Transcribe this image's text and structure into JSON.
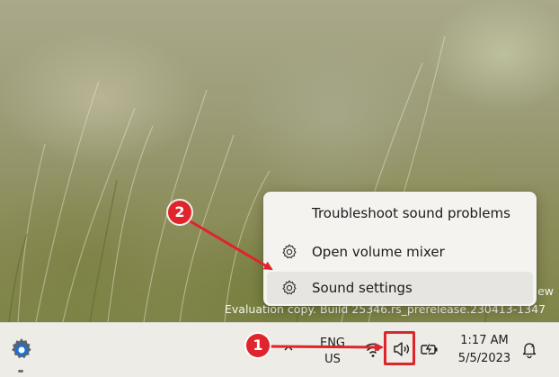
{
  "context_menu": {
    "items": [
      {
        "label": "Troubleshoot sound problems",
        "icon": null
      },
      {
        "label": "Open volume mixer",
        "icon": "gear-icon"
      },
      {
        "label": "Sound settings",
        "icon": "gear-icon"
      }
    ]
  },
  "watermark": {
    "edition_fragment": "ew",
    "build": "Evaluation copy. Build 25346.rs_prerelease.230413-1347"
  },
  "taskbar": {
    "language": {
      "line1": "ENG",
      "line2": "US"
    },
    "clock": {
      "time": "1:17 AM",
      "date": "5/5/2023"
    },
    "tray_icons": [
      "chevron-up-icon",
      "wifi-icon",
      "volume-icon",
      "battery-icon",
      "notification-icon"
    ]
  },
  "annotations": {
    "badge_1": "1",
    "badge_2": "2",
    "accent_color": "#e0242c"
  }
}
